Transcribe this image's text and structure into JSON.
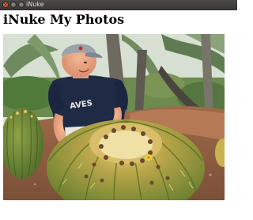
{
  "window": {
    "title": "iNuke"
  },
  "page": {
    "heading": "iNuke My Photos"
  },
  "photo": {
    "shirt_text": "AVES"
  },
  "icons": {
    "close": "close-icon",
    "minimize": "minimize-icon",
    "maximize": "maximize-icon"
  },
  "colors": {
    "titlebar": "#3c3b37",
    "close_button": "#e95420",
    "window_background": "#ffffff"
  }
}
